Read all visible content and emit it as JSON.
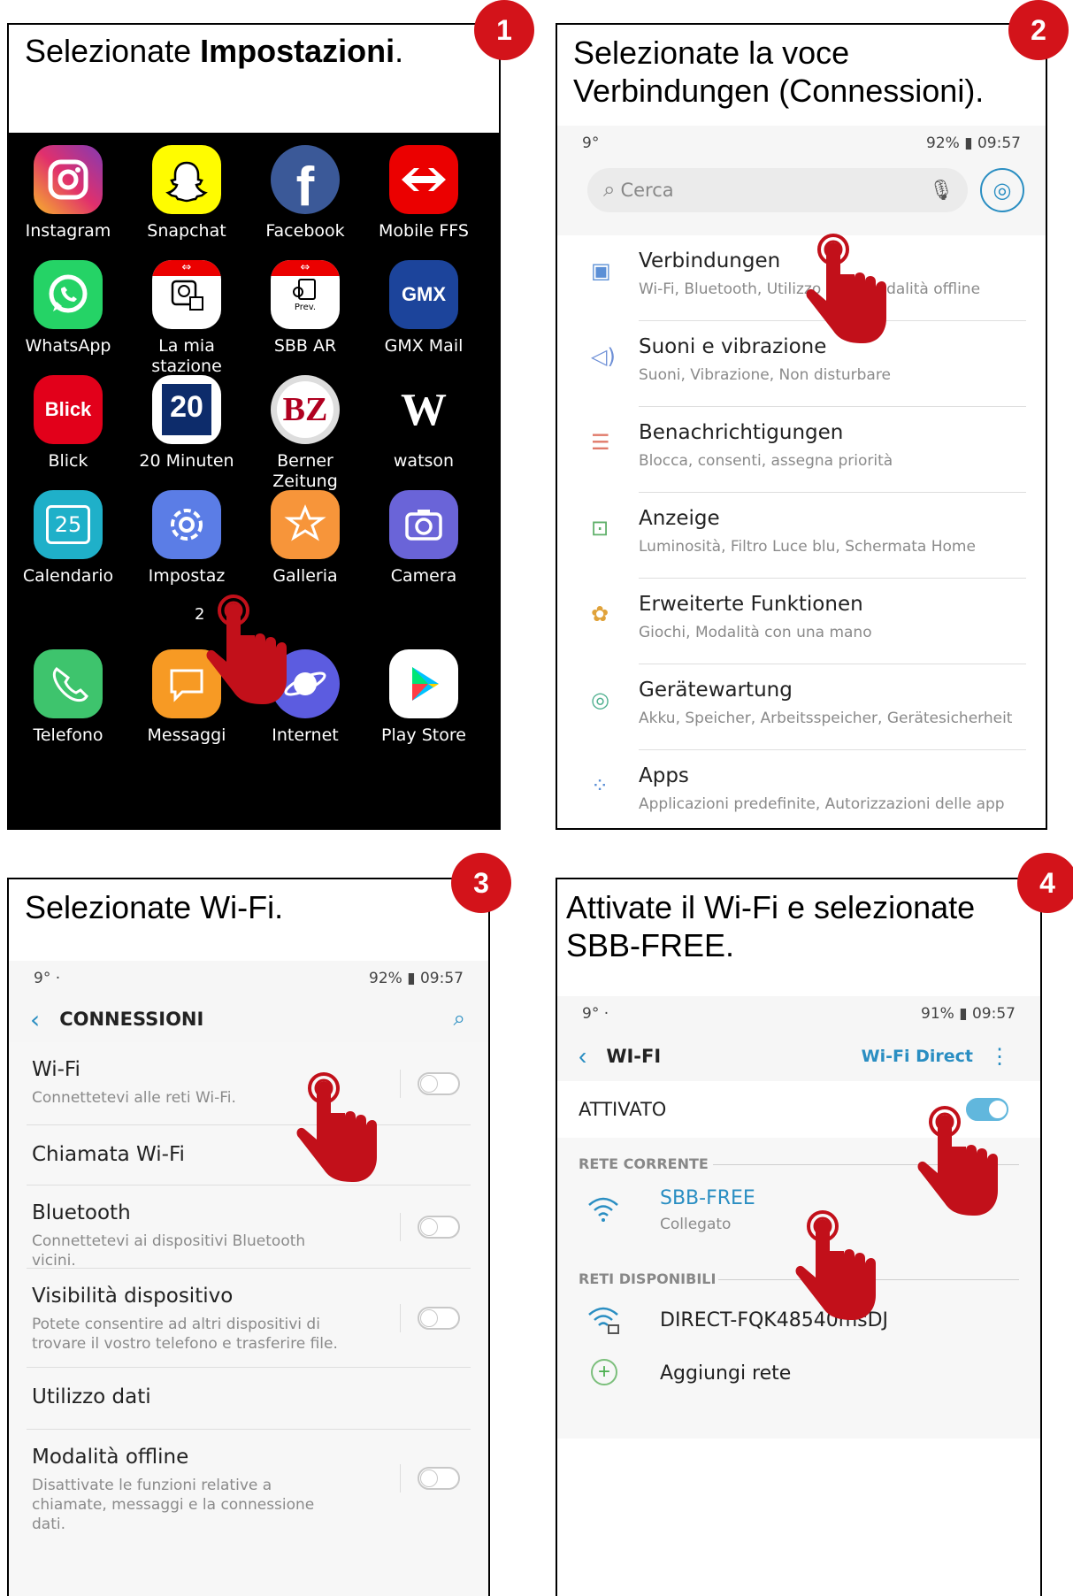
{
  "steps": [
    "1",
    "2",
    "3",
    "4"
  ],
  "panel1": {
    "instruction_pre": "Selezionate ",
    "instruction_bold": "Impostazioni",
    "instruction_post": ".",
    "apps": [
      {
        "label": "Instagram",
        "icon": "instagram-icon"
      },
      {
        "label": "Snapchat",
        "icon": "snapchat-icon"
      },
      {
        "label": "Facebook",
        "icon": "facebook-icon"
      },
      {
        "label": "Mobile FFS",
        "icon": "sbb-icon"
      },
      {
        "label": "WhatsApp",
        "icon": "whatsapp-icon"
      },
      {
        "label": "La mia stazione",
        "icon": "station-icon"
      },
      {
        "label": "SBB AR",
        "icon": "sbb-ar-icon",
        "sub": "Prev."
      },
      {
        "label": "GMX Mail",
        "icon": "gmx-icon",
        "text": "GMX"
      },
      {
        "label": "Blick",
        "icon": "blick-icon",
        "text": "Blick"
      },
      {
        "label": "20 Minuten",
        "icon": "20min-icon",
        "text": "20"
      },
      {
        "label": "Berner Zeitung",
        "icon": "bz-icon",
        "text": "BZ"
      },
      {
        "label": "watson",
        "icon": "watson-icon",
        "text": "W"
      },
      {
        "label": "Calendario",
        "icon": "calendar-icon",
        "text": "25"
      },
      {
        "label": "Impostazioni",
        "icon": "settings-icon"
      },
      {
        "label": "Galleria",
        "icon": "gallery-icon"
      },
      {
        "label": "Camera",
        "icon": "camera-icon"
      },
      {
        "label": "Telefono",
        "icon": "phone-icon"
      },
      {
        "label": "Messaggi",
        "icon": "messages-icon"
      },
      {
        "label": "Internet",
        "icon": "internet-icon"
      },
      {
        "label": "Play Store",
        "icon": "play-store-icon"
      }
    ],
    "visible_labels": [
      "Instagram",
      "Snapchat",
      "Facebook",
      "Mobile FFS",
      "WhatsApp",
      "La mia stazione",
      "SBB AR",
      "GMX Mail",
      "Blick",
      "20 Minuten",
      "Berner Zeitung",
      "watson",
      "Calendario",
      "Impostaz",
      "Galleria",
      "Camera",
      "Telefono",
      "Messaggi",
      "Internet",
      "Play Store"
    ],
    "page_indicator": "2"
  },
  "panel2": {
    "instruction": "Selezionate la voce Verbindungen (Connessioni).",
    "status_left": "9°",
    "status_right": "92% ▮ 09:57",
    "search_placeholder": "Cerca",
    "items": [
      {
        "title": "Verbindungen",
        "sub": "Wi-Fi, Bluetooth, Utilizzo dati, Modalità offline",
        "icon": "connections-icon"
      },
      {
        "title": "Suoni e vibrazione",
        "sub": "Suoni, Vibrazione, Non disturbare",
        "icon": "sound-icon"
      },
      {
        "title": "Benachrichtigungen",
        "sub": "Blocca, consenti, assegna priorità",
        "icon": "notifications-icon"
      },
      {
        "title": "Anzeige",
        "sub": "Luminosità, Filtro Luce blu, Schermata Home",
        "icon": "display-icon"
      },
      {
        "title": "Erweiterte Funktionen",
        "sub": "Giochi, Modalità con una mano",
        "icon": "advanced-icon"
      },
      {
        "title": "Gerätewartung",
        "sub": "Akku, Speicher, Arbeitsspeicher, Gerätesicherheit",
        "icon": "maintenance-icon"
      },
      {
        "title": "Apps",
        "sub": "Applicazioni predefinite, Autorizzazioni delle app",
        "icon": "apps-icon"
      }
    ]
  },
  "panel3": {
    "instruction": "Selezionate Wi-Fi.",
    "status_left": "9°  ·",
    "status_right": "92% ▮ 09:57",
    "header": "CONNESSIONI",
    "items": [
      {
        "title": "Wi-Fi",
        "sub": "Connettetevi alle reti Wi-Fi.",
        "toggle": true
      },
      {
        "title": "Chiamata Wi-Fi",
        "sub": "",
        "toggle": false
      },
      {
        "title": "Bluetooth",
        "sub": "Connettetevi ai dispositivi Bluetooth vicini.",
        "toggle": true
      },
      {
        "title": "Visibilità dispositivo",
        "sub": "Potete consentire ad altri dispositivi di trovare il vostro telefono e trasferire file.",
        "toggle": true
      },
      {
        "title": "Utilizzo dati",
        "sub": "",
        "toggle": false
      },
      {
        "title": "Modalità offline",
        "sub": "Disattivate le funzioni relative a chiamate, messaggi e la connessione dati.",
        "toggle": true
      }
    ]
  },
  "panel4": {
    "instruction": "Attivate il Wi-Fi e selezionate SBB-FREE.",
    "status_left": "9°  ·",
    "status_right": "91% ▮ 09:57",
    "header": "WI-FI",
    "wifi_direct": "Wi-Fi Direct",
    "toggle_label": "ATTIVATO",
    "current_section": "RETE CORRENTE",
    "current_network": "SBB-FREE",
    "current_status": "Collegato",
    "available_section": "RETI DISPONIBILI",
    "available_network": "DIRECT-FQK48540msDJ",
    "add_network": "Aggiungi rete"
  },
  "colors": {
    "accent_red": "#d3131a",
    "link_blue": "#2a8ec2",
    "toggle_on": "#61b7dd"
  }
}
